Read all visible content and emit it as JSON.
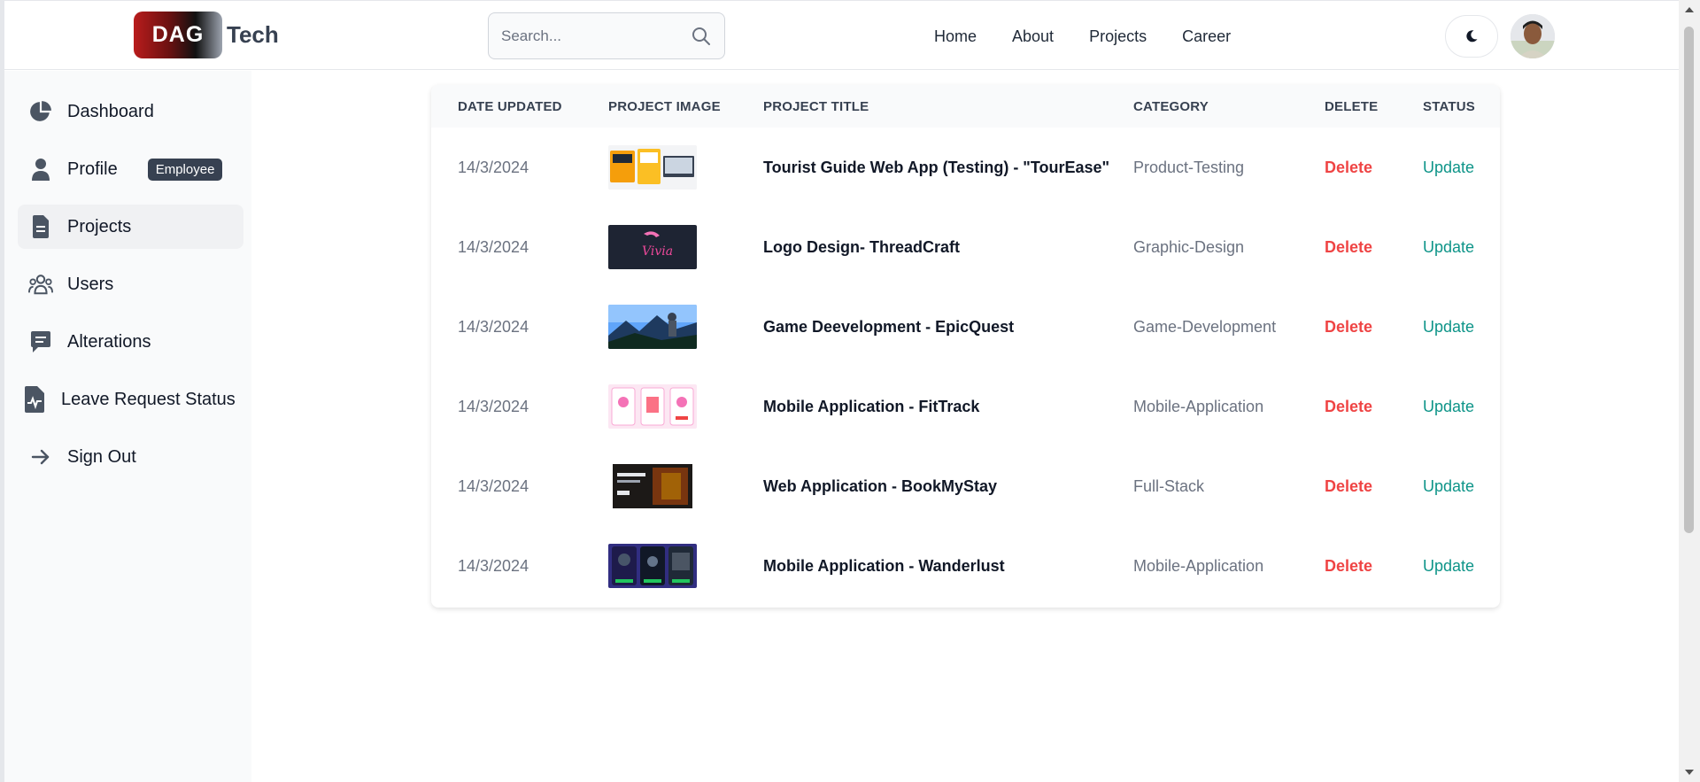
{
  "header": {
    "logo_badge": "DAG",
    "logo_text": "Tech",
    "search_placeholder": "Search...",
    "nav": [
      "Home",
      "About",
      "Projects",
      "Career"
    ]
  },
  "sidebar": {
    "items": [
      {
        "label": "Dashboard",
        "icon": "pie-chart-icon"
      },
      {
        "label": "Profile",
        "icon": "user-icon",
        "badge": "Employee"
      },
      {
        "label": "Projects",
        "icon": "document-icon",
        "active": true
      },
      {
        "label": "Users",
        "icon": "users-icon"
      },
      {
        "label": "Alterations",
        "icon": "chat-icon"
      },
      {
        "label": "Leave Request Status",
        "icon": "file-chart-icon"
      },
      {
        "label": "Sign Out",
        "icon": "arrow-right-icon"
      }
    ]
  },
  "table": {
    "headers": [
      "Date updated",
      "Project image",
      "Project title",
      "Category",
      "Delete",
      "Status"
    ],
    "rows": [
      {
        "date": "14/3/2024",
        "title": "Tourist Guide Web App (Testing) - \"TourEase\"",
        "category": "Product-Testing",
        "delete": "Delete",
        "status": "Update"
      },
      {
        "date": "14/3/2024",
        "title": "Logo Design- ThreadCraft",
        "category": "Graphic-Design",
        "delete": "Delete",
        "status": "Update"
      },
      {
        "date": "14/3/2024",
        "title": "Game Deevelopment - EpicQuest",
        "category": "Game-Development",
        "delete": "Delete",
        "status": "Update"
      },
      {
        "date": "14/3/2024",
        "title": "Mobile Application - FitTrack",
        "category": "Mobile-Application",
        "delete": "Delete",
        "status": "Update"
      },
      {
        "date": "14/3/2024",
        "title": "Web Application - BookMyStay",
        "category": "Full-Stack",
        "delete": "Delete",
        "status": "Update"
      },
      {
        "date": "14/3/2024",
        "title": "Mobile Application - Wanderlust",
        "category": "Mobile-Application",
        "delete": "Delete",
        "status": "Update"
      }
    ]
  },
  "colors": {
    "delete": "#ef4444",
    "update": "#0d9488",
    "badge_bg": "#374151"
  }
}
